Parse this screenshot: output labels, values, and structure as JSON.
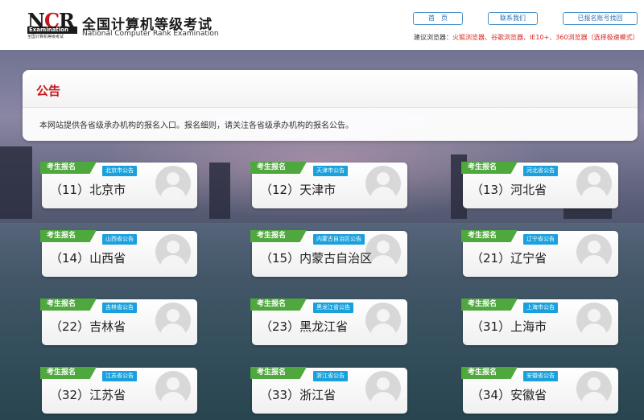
{
  "header": {
    "logo": {
      "letters": "NCR",
      "band": "Examination",
      "small": "全国计算机等级考试"
    },
    "title_cn": "全国计算机等级考试",
    "title_en": "National Computer Rank Examination",
    "nav": {
      "home": "首　页",
      "contact": "联系我们",
      "find_account": "已报名账号找回"
    },
    "browser_tip_label": "建议浏览器：",
    "browser_tip_list": "火狐浏览器、谷歌浏览器、IE10+、360浏览器（选择极速模式）"
  },
  "notice": {
    "title": "公告",
    "body": "本网站提供各省级承办机构的报名入口。报名细则，请关注各省级承办机构的报名公告。"
  },
  "cards": [
    {
      "ribbon": "考生报名",
      "tag": "北京市公告",
      "name": "（11）北京市"
    },
    {
      "ribbon": "考生报名",
      "tag": "天津市公告",
      "name": "（12）天津市"
    },
    {
      "ribbon": "考生报名",
      "tag": "河北省公告",
      "name": "（13）河北省"
    },
    {
      "ribbon": "考生报名",
      "tag": "山西省公告",
      "name": "（14）山西省"
    },
    {
      "ribbon": "考生报名",
      "tag": "内蒙古自治区公告",
      "name": "（15）内蒙古自治区"
    },
    {
      "ribbon": "考生报名",
      "tag": "辽宁省公告",
      "name": "（21）辽宁省"
    },
    {
      "ribbon": "考生报名",
      "tag": "吉林省公告",
      "name": "（22）吉林省"
    },
    {
      "ribbon": "考生报名",
      "tag": "黑龙江省公告",
      "name": "（23）黑龙江省"
    },
    {
      "ribbon": "考生报名",
      "tag": "上海市公告",
      "name": "（31）上海市"
    },
    {
      "ribbon": "考生报名",
      "tag": "江苏省公告",
      "name": "（32）江苏省"
    },
    {
      "ribbon": "考生报名",
      "tag": "浙江省公告",
      "name": "（33）浙江省"
    },
    {
      "ribbon": "考生报名",
      "tag": "安徽省公告",
      "name": "（34）安徽省"
    }
  ],
  "colors": {
    "brand_red": "#c8161d",
    "ribbon_green": "#4fa83d",
    "tag_blue": "#1aa0dc",
    "link_blue": "#2a6fb0"
  }
}
